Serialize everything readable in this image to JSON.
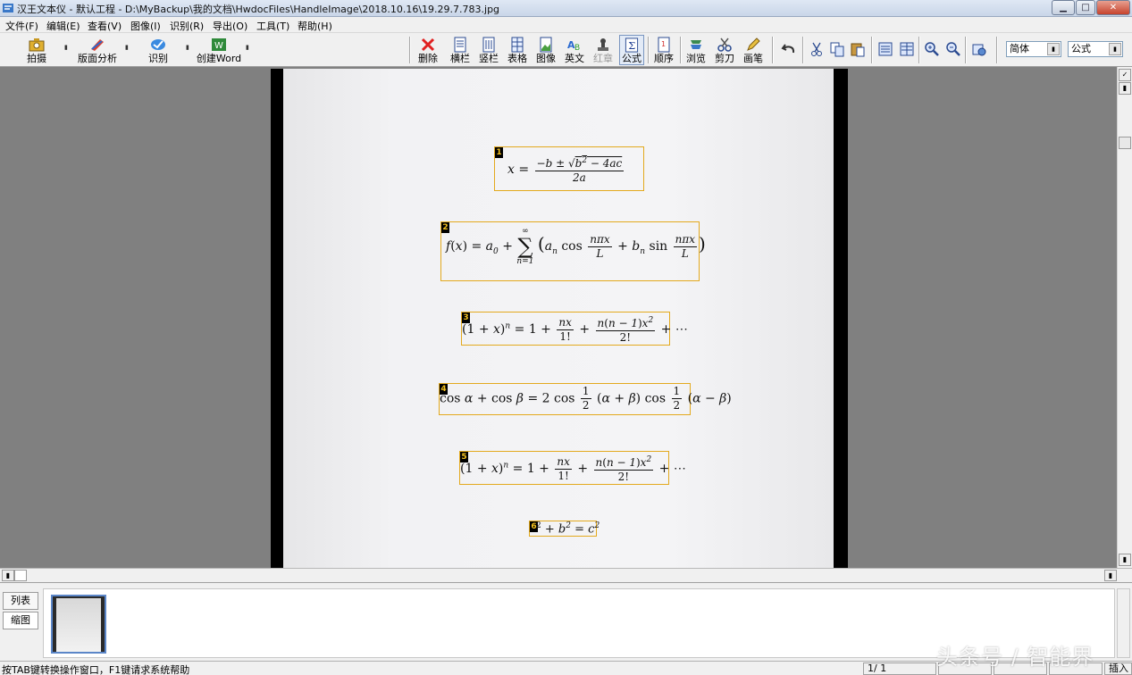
{
  "window": {
    "title": "汉王文本仪 - 默认工程 - D:\\MyBackup\\我的文档\\HwdocFiles\\HandleImage\\2018.10.16\\19.29.7.783.jpg"
  },
  "menu": [
    "文件(F)",
    "编辑(E)",
    "查看(V)",
    "图像(I)",
    "识别(R)",
    "导出(O)",
    "工具(T)",
    "帮助(H)"
  ],
  "toolbar": {
    "capture": "拍摄",
    "layout_analysis": "版面分析",
    "recognize": "识别",
    "create_word": "创建Word",
    "delete": "删除",
    "horizontal": "横栏",
    "vertical": "竖栏",
    "table": "表格",
    "image": "图像",
    "english": "英文",
    "stamp": "红章",
    "formula": "公式",
    "order": "顺序",
    "browse": "浏览",
    "cut": "剪刀",
    "pen": "画笔",
    "font_combo": "简体",
    "mode_combo": "公式"
  },
  "formulas": [
    {
      "num": "1"
    },
    {
      "num": "2"
    },
    {
      "num": "3"
    },
    {
      "num": "4"
    },
    {
      "num": "5"
    },
    {
      "num": "6"
    }
  ],
  "panel": {
    "tab_list": "列表",
    "tab_thumb": "缩图"
  },
  "status": {
    "help": "按TAB键转换操作窗口，F1键请求系统帮助",
    "page": "1/   1",
    "insert": "插入"
  },
  "watermark": "头条号 / 智能界"
}
